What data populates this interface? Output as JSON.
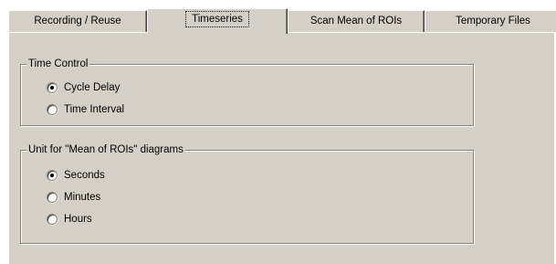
{
  "tabs": [
    {
      "label": "Recording / Reuse",
      "selected": false
    },
    {
      "label": "Timeseries",
      "selected": true
    },
    {
      "label": "Scan Mean of ROIs",
      "selected": false
    },
    {
      "label": "Temporary Files",
      "selected": false
    }
  ],
  "time_control": {
    "title": "Time Control",
    "options": [
      {
        "label": "Cycle Delay",
        "checked": true
      },
      {
        "label": "Time Interval",
        "checked": false
      }
    ]
  },
  "unit_group": {
    "title": "Unit for \"Mean of ROIs\" diagrams",
    "options": [
      {
        "label": "Seconds",
        "checked": true
      },
      {
        "label": "Minutes",
        "checked": false
      },
      {
        "label": "Hours",
        "checked": false
      }
    ]
  },
  "colors": {
    "face": "#d4d0c8",
    "shadow": "#808080",
    "highlight": "#ffffff"
  }
}
